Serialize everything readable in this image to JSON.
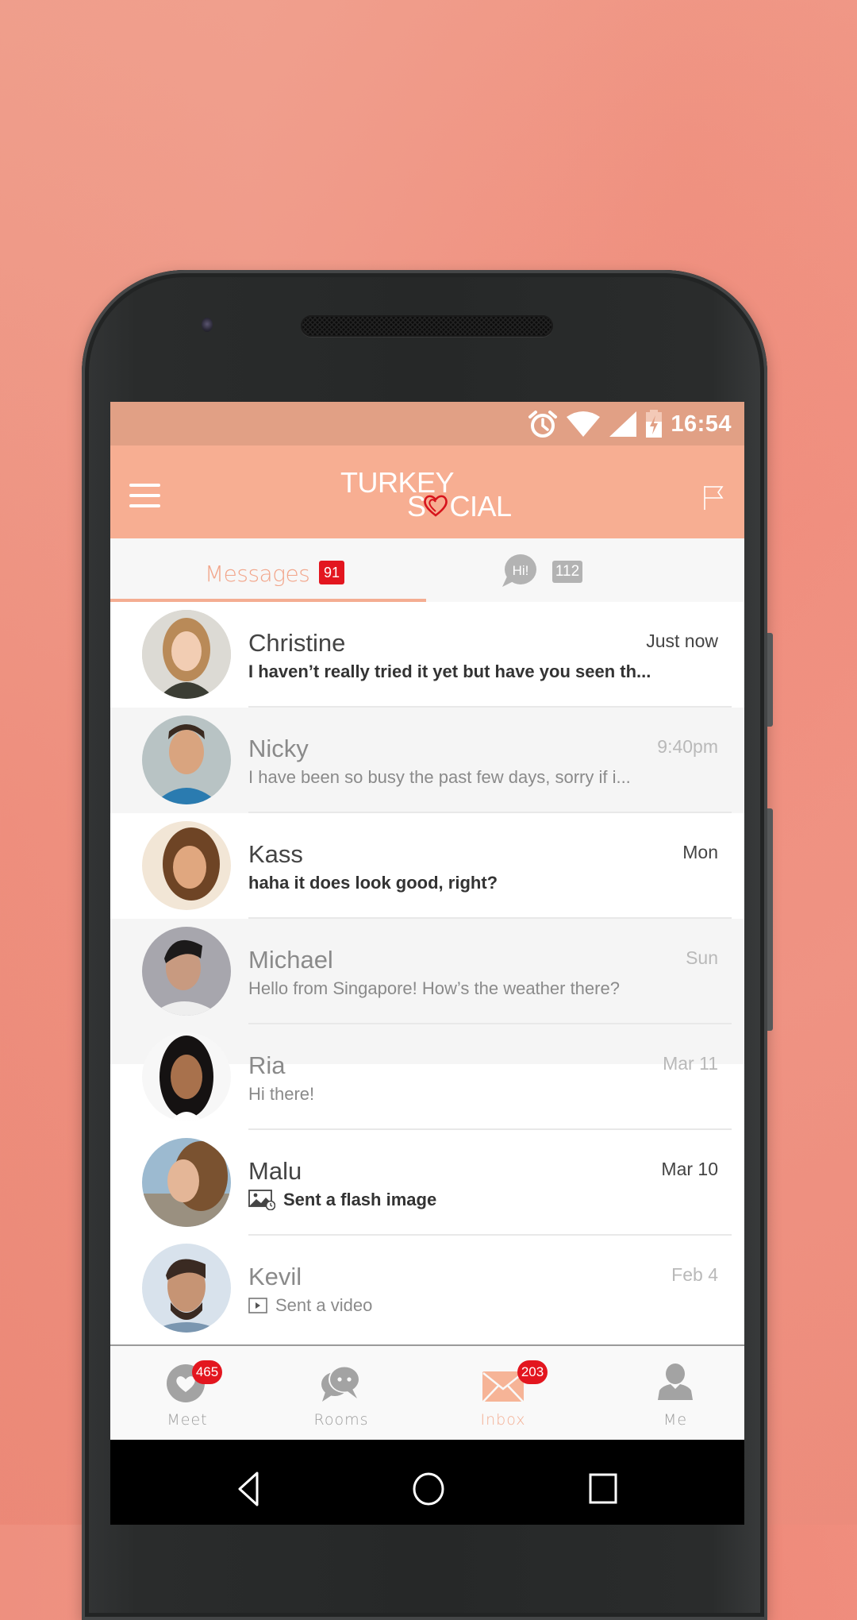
{
  "status_bar": {
    "time": "16:54",
    "icons": [
      "alarm-icon",
      "wifi-icon",
      "signal-icon",
      "battery-charging-icon"
    ]
  },
  "header": {
    "logo_line1": "TURKEY",
    "logo_line2": "S",
    "logo_line2_rest": "CIAL",
    "menu_icon": "hamburger-menu-icon",
    "report_icon": "flag-icon"
  },
  "tabs": [
    {
      "label": "Messages",
      "badge": "91",
      "active": true
    },
    {
      "label": "Hi!",
      "badge": "112",
      "active": false
    }
  ],
  "conversations": [
    {
      "name": "Christine",
      "time": "Just now",
      "preview": "I haven’t really tried it yet but have you seen th...",
      "unread": true,
      "attachment": null
    },
    {
      "name": "Nicky",
      "time": "9:40pm",
      "preview": "I have been so busy the past few days, sorry if i...",
      "unread": false,
      "attachment": null
    },
    {
      "name": "Kass",
      "time": "Mon",
      "preview": "haha it does look good, right?",
      "unread": true,
      "attachment": null
    },
    {
      "name": "Michael",
      "time": "Sun",
      "preview": "Hello from Singapore! How’s the weather there?",
      "unread": false,
      "attachment": null
    },
    {
      "name": "Ria",
      "time": "Mar 11",
      "preview": "Hi there!",
      "unread": false,
      "attachment": null
    },
    {
      "name": "Malu",
      "time": "Mar 10",
      "preview": "Sent a flash image",
      "unread": true,
      "attachment": "flash-image-icon"
    },
    {
      "name": "Kevil",
      "time": "Feb 4",
      "preview": "Sent a video",
      "unread": false,
      "attachment": "video-icon"
    }
  ],
  "bottom_nav": [
    {
      "label": "Meet",
      "icon": "heart-icon",
      "badge": "465",
      "active": false
    },
    {
      "label": "Rooms",
      "icon": "chat-bubbles-icon",
      "badge": null,
      "active": false
    },
    {
      "label": "Inbox",
      "icon": "envelope-icon",
      "badge": "203",
      "active": true
    },
    {
      "label": "Me",
      "icon": "person-icon",
      "badge": null,
      "active": false
    }
  ],
  "colors": {
    "brand": "#f7ae92",
    "status_bar": "#e1a085",
    "badge_red": "#e3161f",
    "active_tab": "#f2a58a",
    "inactive_gray": "#9c9c9c"
  }
}
